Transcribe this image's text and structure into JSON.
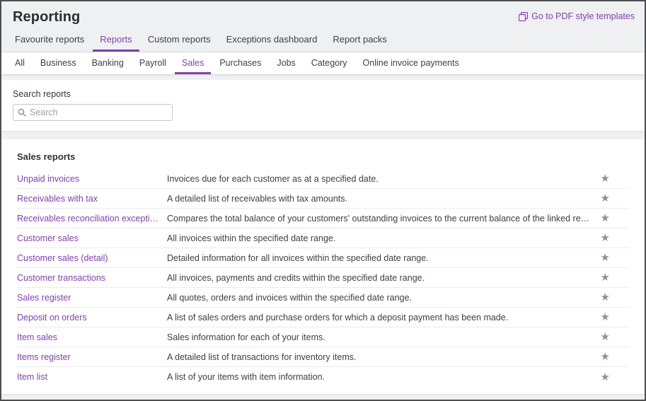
{
  "header": {
    "title": "Reporting",
    "pdf_link_label": "Go to PDF style templates"
  },
  "tabs": {
    "items": [
      {
        "label": "Favourite reports",
        "active": false
      },
      {
        "label": "Reports",
        "active": true
      },
      {
        "label": "Custom reports",
        "active": false
      },
      {
        "label": "Exceptions dashboard",
        "active": false
      },
      {
        "label": "Report packs",
        "active": false
      }
    ]
  },
  "subtabs": {
    "items": [
      {
        "label": "All",
        "active": false
      },
      {
        "label": "Business",
        "active": false
      },
      {
        "label": "Banking",
        "active": false
      },
      {
        "label": "Payroll",
        "active": false
      },
      {
        "label": "Sales",
        "active": true
      },
      {
        "label": "Purchases",
        "active": false
      },
      {
        "label": "Jobs",
        "active": false
      },
      {
        "label": "Category",
        "active": false
      },
      {
        "label": "Online invoice payments",
        "active": false
      }
    ]
  },
  "search": {
    "label": "Search reports",
    "placeholder": "Search"
  },
  "reports": {
    "heading": "Sales reports",
    "star_glyph": "★",
    "rows": [
      {
        "name": "Unpaid invoices",
        "description": "Invoices due for each customer as at a specified date."
      },
      {
        "name": "Receivables with tax",
        "description": "A detailed list of receivables with tax amounts."
      },
      {
        "name": "Receivables reconciliation exceptions",
        "description": "Compares the total balance of your customers' outstanding invoices to the current balance of the linked receivables account."
      },
      {
        "name": "Customer sales",
        "description": "All invoices within the specified date range."
      },
      {
        "name": "Customer sales (detail)",
        "description": "Detailed information for all invoices within the specified date range."
      },
      {
        "name": "Customer transactions",
        "description": "All invoices, payments and credits within the specified date range."
      },
      {
        "name": "Sales register",
        "description": "All quotes, orders and invoices within the specified date range."
      },
      {
        "name": "Deposit on orders",
        "description": "A list of sales orders and purchase orders for which a deposit payment has been made."
      },
      {
        "name": "Item sales",
        "description": "Sales information for each of your items."
      },
      {
        "name": "Items register",
        "description": "A detailed list of transactions for inventory items."
      },
      {
        "name": "Item list",
        "description": "A list of your items with item information."
      }
    ]
  },
  "colors": {
    "accent": "#8241aa",
    "star": "#8d9095",
    "page_background": "#eff0f2",
    "card_background": "#ffffff"
  }
}
